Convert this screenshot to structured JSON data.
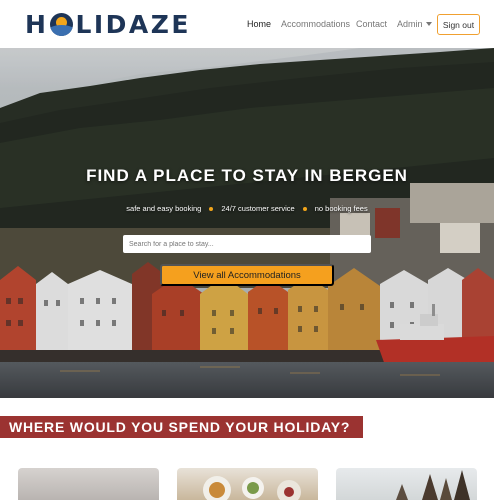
{
  "brand": {
    "name_left": "H",
    "name_right": "LIDAZE"
  },
  "nav": {
    "home": "Home",
    "accommodations": "Accommodations",
    "contact": "Contact",
    "admin": "Admin",
    "sign_out": "Sign out"
  },
  "hero": {
    "title": "FIND A PLACE TO STAY IN BERGEN",
    "features": [
      "safe and easy booking",
      "24/7 customer service",
      "no booking fees"
    ],
    "search_placeholder": "Search for a place to stay...",
    "cta": "View all Accommodations"
  },
  "section": {
    "heading": "WHERE WOULD YOU SPEND YOUR HOLIDAY?"
  },
  "colors": {
    "brand_navy": "#1e3557",
    "accent_orange": "#f5a01e",
    "banner_red": "#9b3331"
  },
  "icons": {
    "logo_mark": "sun-over-hill-icon",
    "admin_caret": "caret-down-icon"
  }
}
